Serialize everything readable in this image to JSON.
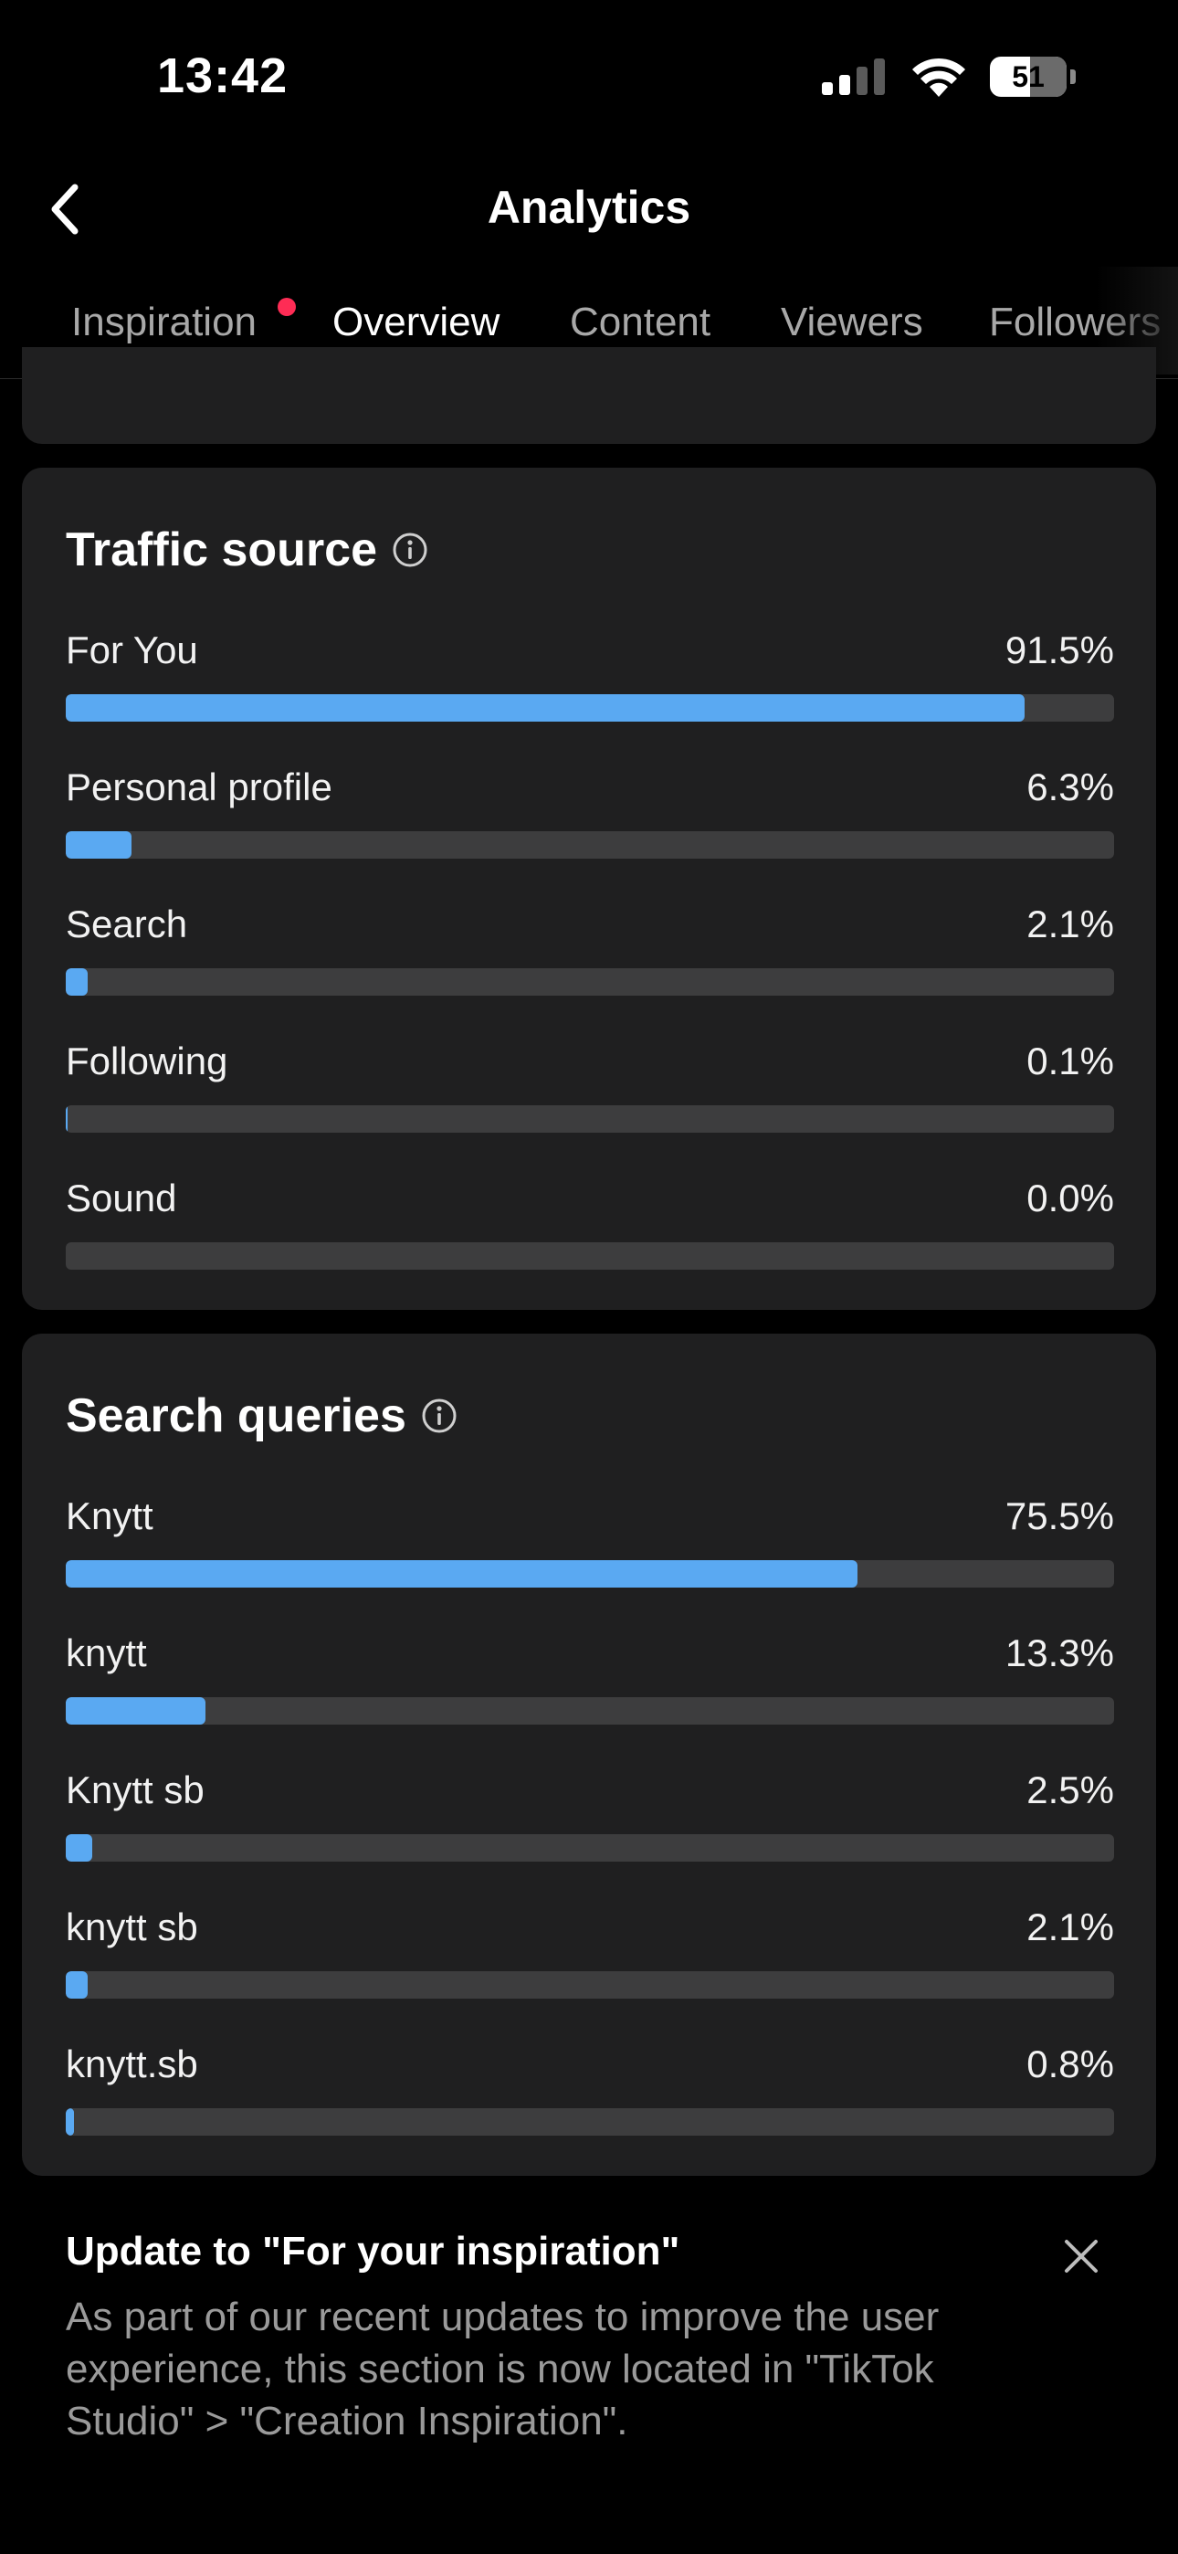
{
  "status_bar": {
    "time": "13:42",
    "battery": "51"
  },
  "header": {
    "title": "Analytics"
  },
  "tabs": [
    {
      "label": "Inspiration",
      "active": false,
      "has_dot": true
    },
    {
      "label": "Overview",
      "active": true
    },
    {
      "label": "Content",
      "active": false
    },
    {
      "label": "Viewers",
      "active": false
    },
    {
      "label": "Followers",
      "active": false
    }
  ],
  "traffic_source": {
    "title": "Traffic source",
    "items": [
      {
        "label": "For You",
        "value": "91.5%",
        "percent": 91.5
      },
      {
        "label": "Personal profile",
        "value": "6.3%",
        "percent": 6.3
      },
      {
        "label": "Search",
        "value": "2.1%",
        "percent": 2.1
      },
      {
        "label": "Following",
        "value": "0.1%",
        "percent": 0.1
      },
      {
        "label": "Sound",
        "value": "0.0%",
        "percent": 0.0
      }
    ]
  },
  "search_queries": {
    "title": "Search queries",
    "items": [
      {
        "label": "Knytt",
        "value": "75.5%",
        "percent": 75.5
      },
      {
        "label": "knytt",
        "value": "13.3%",
        "percent": 13.3
      },
      {
        "label": "Knytt sb",
        "value": "2.5%",
        "percent": 2.5
      },
      {
        "label": "knytt sb",
        "value": "2.1%",
        "percent": 2.1
      },
      {
        "label": "knytt.sb",
        "value": "0.8%",
        "percent": 0.8
      }
    ]
  },
  "notice": {
    "title": "Update to \"For your inspiration\"",
    "body": "As part of our recent updates to improve the user experience, this section is now located in \"TikTok Studio\" > \"Creation Inspiration\"."
  },
  "colors": {
    "accent_bar": "#5aa9f2",
    "track": "#3d3d3e",
    "card": "#1f1f20",
    "dot": "#fe2c55"
  }
}
